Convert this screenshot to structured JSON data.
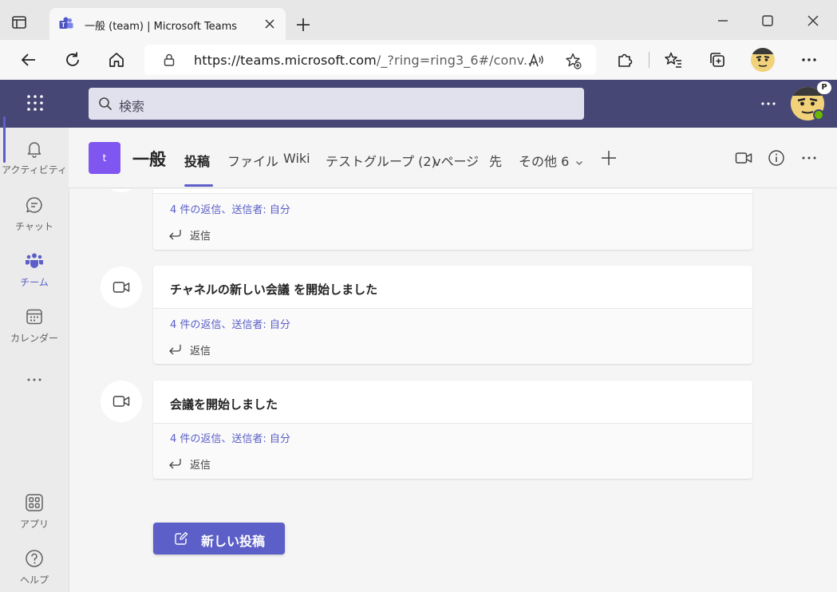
{
  "browser": {
    "tab_title": "一般 (team) | Microsoft Teams",
    "url_host": "https://teams.microsoft.com",
    "url_path": "/_?ring=ring3_6#/conv...",
    "icons": [
      "sidebar-icon",
      "teams-icon",
      "close-icon",
      "plus-icon",
      "minimize-icon",
      "maximize-icon",
      "window-close-icon",
      "back-icon",
      "refresh-icon",
      "home-icon",
      "lock-icon",
      "read-aloud-icon",
      "add-favorite-icon",
      "extensions-icon",
      "favorites-icon",
      "collections-icon",
      "avatar",
      "more-icon"
    ]
  },
  "teams_header": {
    "search_placeholder": "検索",
    "presence_badge": "P"
  },
  "rail": {
    "items": [
      {
        "label": "アクティビティ",
        "icon": "bell-icon"
      },
      {
        "label": "チャット",
        "icon": "chat-icon"
      },
      {
        "label": "チーム",
        "icon": "teams-people-icon",
        "active": true
      },
      {
        "label": "カレンダー",
        "icon": "calendar-icon"
      },
      {
        "label": "アプリ",
        "icon": "apps-icon"
      },
      {
        "label": "ヘルプ",
        "icon": "help-icon"
      }
    ]
  },
  "channel": {
    "team_initial": "t",
    "name": "一般",
    "tabs": [
      "投稿",
      "ファイル",
      "Wiki",
      "テストグループ (2)",
      "vページ",
      "先",
      "その他 6"
    ]
  },
  "posts": [
    {
      "title": "",
      "replies": "4 件の返信、送信者: 自分",
      "reply_label": "返信"
    },
    {
      "title": "チャネルの新しい会議 を開始しました",
      "replies": "4 件の返信、送信者: 自分",
      "reply_label": "返信"
    },
    {
      "title": "会議を開始しました",
      "replies": "4 件の返信、送信者: 自分",
      "reply_label": "返信"
    }
  ],
  "new_post_label": "新しい投稿",
  "colors": {
    "teams_header": "#464775",
    "accent": "#5b5fc7",
    "team_tile": "#7f56f0",
    "presence": "#6bb700"
  }
}
